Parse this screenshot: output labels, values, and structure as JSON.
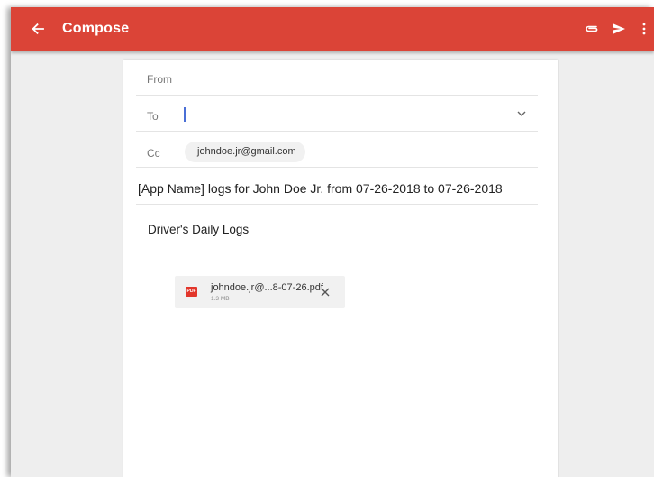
{
  "appbar": {
    "title": "Compose",
    "background_color": "#db4437",
    "icons": [
      "arrow-back-icon",
      "paperclip-icon",
      "send-icon",
      "more-vert-icon"
    ]
  },
  "form": {
    "from_label": "From",
    "to_label": "To",
    "to_value": "",
    "cc_label": "Cc",
    "cc_chip": "johndoe.jr@gmail.com",
    "subject": "[App Name] logs for John Doe Jr. from 07-26-2018 to 07-26-2018",
    "body": "Driver's Daily Logs"
  },
  "attachment": {
    "icon_text": "PDF",
    "filename": "johndoe.jr@...8-07-26.pdf",
    "size": "1.3 MB"
  }
}
